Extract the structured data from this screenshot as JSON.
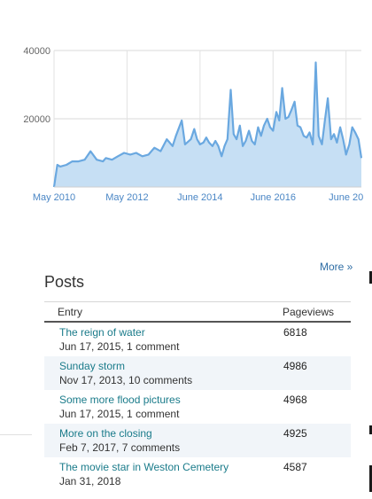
{
  "chart_data": {
    "type": "area",
    "color": "#6aa8e0",
    "fill": "#c6dff4",
    "ylim": [
      0,
      40000
    ],
    "y_ticks": [
      "40000",
      "20000"
    ],
    "x_ticks": [
      "May 2010",
      "May 2012",
      "June 2014",
      "June 2016",
      "June 20"
    ],
    "x": [
      2010.33,
      2010.42,
      2010.5,
      2010.67,
      2010.83,
      2011.0,
      2011.17,
      2011.33,
      2011.5,
      2011.67,
      2011.75,
      2011.92,
      2012.08,
      2012.25,
      2012.42,
      2012.58,
      2012.75,
      2012.92,
      2013.08,
      2013.25,
      2013.42,
      2013.58,
      2013.67,
      2013.83,
      2013.92,
      2014.08,
      2014.17,
      2014.25,
      2014.33,
      2014.42,
      2014.5,
      2014.58,
      2014.67,
      2014.75,
      2014.83,
      2014.92,
      2015.0,
      2015.08,
      2015.17,
      2015.25,
      2015.33,
      2015.42,
      2015.5,
      2015.58,
      2015.67,
      2015.75,
      2015.83,
      2015.92,
      2016.0,
      2016.08,
      2016.17,
      2016.25,
      2016.33,
      2016.42,
      2016.5,
      2016.58,
      2016.67,
      2016.75,
      2016.83,
      2016.92,
      2017.0,
      2017.08,
      2017.17,
      2017.25,
      2017.33,
      2017.42,
      2017.5,
      2017.58,
      2017.67,
      2017.75,
      2017.83,
      2017.92,
      2018.0,
      2018.08,
      2018.17,
      2018.25,
      2018.33,
      2018.42,
      2018.5,
      2018.58,
      2018.67,
      2018.75
    ],
    "values": [
      0,
      6500,
      6000,
      6500,
      7500,
      7500,
      8000,
      10500,
      8000,
      7500,
      8500,
      8000,
      9000,
      10000,
      9500,
      10000,
      9000,
      9500,
      11500,
      10500,
      14000,
      12000,
      15000,
      19500,
      12500,
      14000,
      17000,
      14000,
      12500,
      13000,
      14500,
      13000,
      12000,
      13500,
      12000,
      9000,
      12000,
      14000,
      28500,
      15500,
      14000,
      18000,
      12000,
      13500,
      16500,
      13500,
      12500,
      17500,
      15000,
      18000,
      20000,
      17500,
      16500,
      22000,
      19500,
      29000,
      20000,
      20500,
      22500,
      25000,
      18000,
      17500,
      15000,
      14500,
      16000,
      12500,
      36500,
      15000,
      12500,
      19500,
      26000,
      14000,
      15500,
      13000,
      17500,
      14000,
      9500,
      12500,
      17500,
      16000,
      14000,
      8500
    ],
    "title": "",
    "xlabel": "",
    "ylabel": ""
  },
  "more_link": "More »",
  "posts": {
    "title": "Posts",
    "headers": {
      "entry": "Entry",
      "pageviews": "Pageviews"
    },
    "rows": [
      {
        "title": "The reign of water",
        "meta": "Jun 17, 2015, 1 comment",
        "views": "6818"
      },
      {
        "title": "Sunday storm",
        "meta": "Nov 17, 2013, 10 comments",
        "views": "4986"
      },
      {
        "title": "Some more flood pictures",
        "meta": "Jun 17, 2015, 1 comment",
        "views": "4968"
      },
      {
        "title": "More on the closing",
        "meta": "Feb 7, 2017, 7 comments",
        "views": "4925"
      },
      {
        "title": "The movie star in Weston Cemetery",
        "meta": "Jan 31, 2018",
        "views": "4587"
      }
    ]
  }
}
